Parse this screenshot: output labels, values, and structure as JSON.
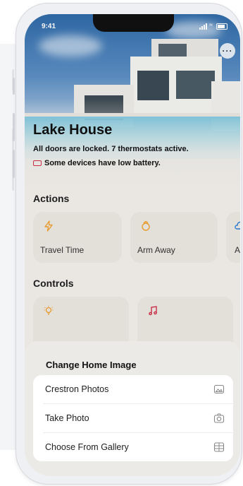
{
  "status_bar": {
    "time": "9:41"
  },
  "home": {
    "title": "Lake House",
    "status": "All doors are locked. 7 thermostats active.",
    "battery_warning": "Some devices have low battery."
  },
  "sections": {
    "actions": "Actions",
    "controls": "Controls"
  },
  "actions": [
    {
      "label": "Travel Time",
      "icon": "lightning-icon"
    },
    {
      "label": "Arm Away",
      "icon": "alarm-icon"
    },
    {
      "label": "Au",
      "icon": "cloud-icon"
    }
  ],
  "controls": [
    {
      "label": "",
      "icon": "lightbulb-icon"
    },
    {
      "label": "",
      "icon": "music-note-icon"
    }
  ],
  "sheet": {
    "title": "Change Home Image",
    "options": [
      {
        "label": "Crestron Photos",
        "icon": "image-icon"
      },
      {
        "label": "Take Photo",
        "icon": "camera-icon"
      },
      {
        "label": "Choose From Gallery",
        "icon": "grid-icon"
      }
    ]
  },
  "colors": {
    "warning": "#d0304a",
    "accent_orange": "#f0a030",
    "accent_pink": "#d0304a",
    "accent_blue": "#2a7ad6"
  }
}
